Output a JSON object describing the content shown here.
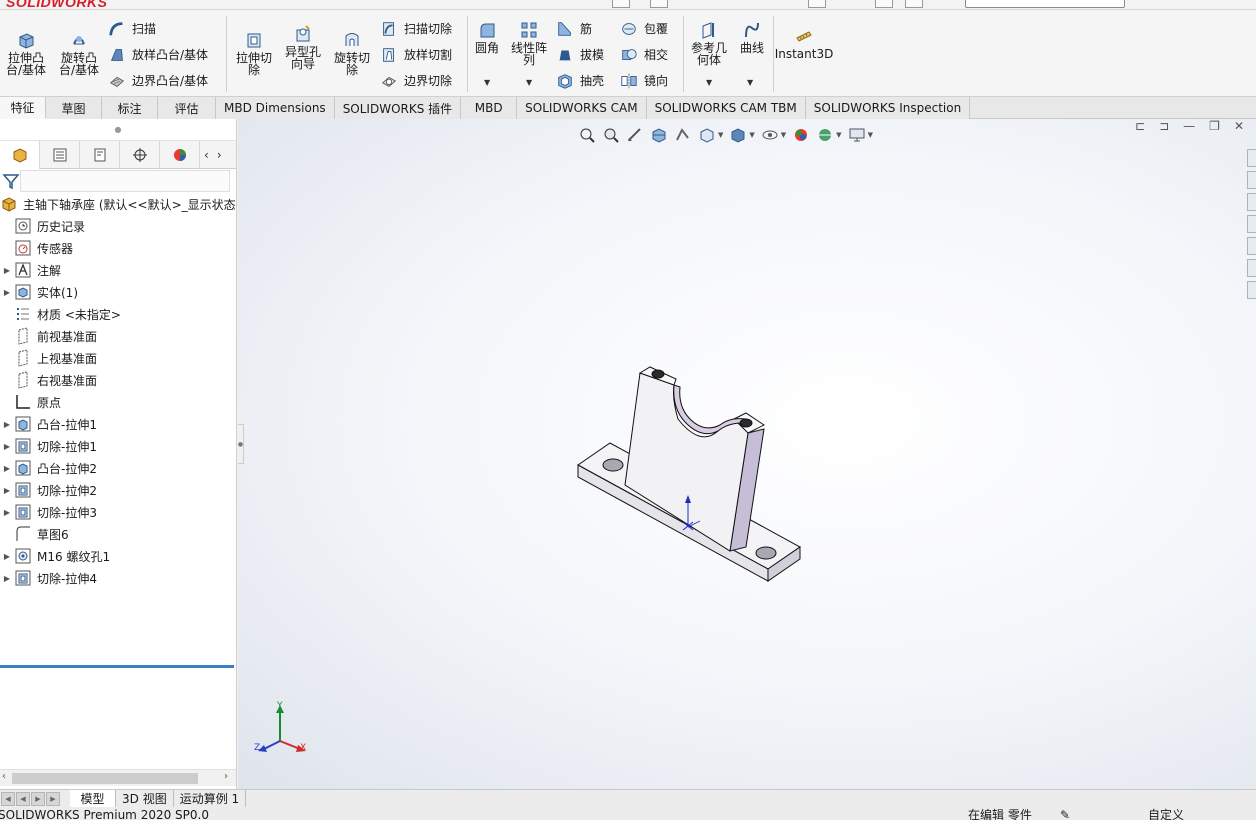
{
  "app": {
    "logo": "SOLIDWORKS"
  },
  "toolbar": {
    "extrude_boss": "拉伸凸台/基体",
    "revolve_boss": "旋转凸台/基体",
    "sweep": "扫描",
    "loft_boss": "放样凸台/基体",
    "boundary_boss": "边界凸台/基体",
    "extrude_cut": "拉伸切除",
    "hole_wizard": "异型孔向导",
    "revolve_cut": "旋转切除",
    "swept_cut": "扫描切除",
    "lofted_cut": "放样切割",
    "boundary_cut": "边界切除",
    "fillet": "圆角",
    "linear_pattern": "线性阵列",
    "rib": "筋",
    "draft": "拔模",
    "shell": "抽壳",
    "wrap": "包覆",
    "intersect": "相交",
    "mirror": "镜向",
    "ref_geometry": "参考几何体",
    "curves": "曲线",
    "instant3d": "Instant3D"
  },
  "tabs": [
    {
      "label": "特征",
      "active": true
    },
    {
      "label": "草图"
    },
    {
      "label": "标注"
    },
    {
      "label": "评估"
    },
    {
      "label": "MBD Dimensions"
    },
    {
      "label": "SOLIDWORKS 插件"
    },
    {
      "label": "MBD"
    },
    {
      "label": "SOLIDWORKS CAM"
    },
    {
      "label": "SOLIDWORKS CAM TBM"
    },
    {
      "label": "SOLIDWORKS Inspection"
    }
  ],
  "feature_tree": {
    "root": "主轴下轴承座 (默认<<默认>_显示状态",
    "items": [
      {
        "label": "历史记录",
        "icon": "history-icon",
        "expandable": false
      },
      {
        "label": "传感器",
        "icon": "sensor-icon",
        "expandable": false
      },
      {
        "label": "注解",
        "icon": "annotation-icon",
        "expandable": true
      },
      {
        "label": "实体(1)",
        "icon": "solid-body-icon",
        "expandable": true
      },
      {
        "label": "材质 <未指定>",
        "icon": "material-icon",
        "expandable": false
      },
      {
        "label": "前视基准面",
        "icon": "plane-icon",
        "expandable": false
      },
      {
        "label": "上视基准面",
        "icon": "plane-icon",
        "expandable": false
      },
      {
        "label": "右视基准面",
        "icon": "plane-icon",
        "expandable": false
      },
      {
        "label": "原点",
        "icon": "origin-icon",
        "expandable": false
      },
      {
        "label": "凸台-拉伸1",
        "icon": "boss-extrude-icon",
        "expandable": true
      },
      {
        "label": "切除-拉伸1",
        "icon": "cut-extrude-icon",
        "expandable": true
      },
      {
        "label": "凸台-拉伸2",
        "icon": "boss-extrude-icon",
        "expandable": true
      },
      {
        "label": "切除-拉伸2",
        "icon": "cut-extrude-icon",
        "expandable": true
      },
      {
        "label": "切除-拉伸3",
        "icon": "cut-extrude-icon",
        "expandable": true
      },
      {
        "label": "草图6",
        "icon": "sketch-icon",
        "expandable": false
      },
      {
        "label": "M16 螺纹孔1",
        "icon": "hole-icon",
        "expandable": true
      },
      {
        "label": "切除-拉伸4",
        "icon": "cut-extrude-icon",
        "expandable": true
      }
    ]
  },
  "triad": {
    "x": "X",
    "y": "Y",
    "z": "Z"
  },
  "bottom_tabs": [
    "模型",
    "3D 视图",
    "运动算例 1"
  ],
  "status": {
    "left": "SOLIDWORKS Premium 2020 SP0.0",
    "editing": "在编辑 零件",
    "units": "自定义"
  },
  "colors": {
    "accent": "#3b7fc4",
    "logo_red": "#d61e2b"
  }
}
